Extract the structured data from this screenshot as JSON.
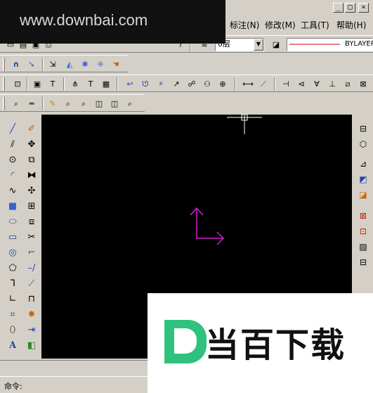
{
  "watermark": {
    "url": "www.downbai.com",
    "logo_text": "当百下载",
    "logo_letter": "D"
  },
  "window": {
    "minimize": "_",
    "maximize": "□",
    "close": "×"
  },
  "menu": {
    "items": [
      {
        "label": "标注(N)"
      },
      {
        "label": "修改(M)"
      },
      {
        "label": "工具(T)"
      },
      {
        "label": "帮助(H)"
      }
    ]
  },
  "properties": {
    "layer_value": "0层",
    "linetype_value": "BYLAYER",
    "linetype_color": "#cc0000"
  },
  "command": {
    "prompt": "命令:"
  },
  "colors": {
    "canvas": "#000000",
    "ucs_icon": "#cc22cc",
    "crosshair": "#ffffff"
  }
}
